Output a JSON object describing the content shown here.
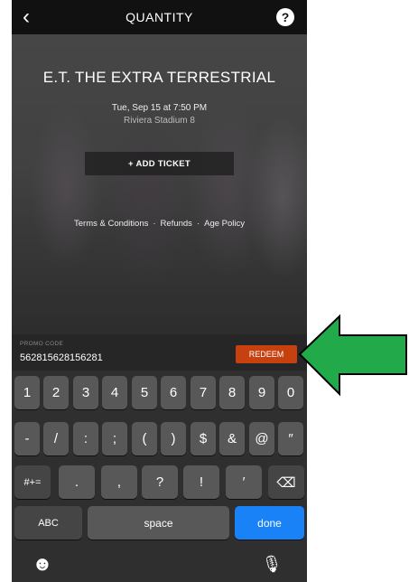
{
  "header": {
    "title": "QUANTITY",
    "back_glyph": "‹",
    "help_glyph": "?"
  },
  "event": {
    "title": "E.T. THE EXTRA TERRESTRIAL",
    "showtime": "Tue, Sep 15 at 7:50 PM",
    "theater": "Riviera Stadium 8",
    "add_ticket": "+ ADD TICKET"
  },
  "links": {
    "terms": "Terms & Conditions",
    "refunds": "Refunds",
    "age": "Age Policy",
    "separator": "·"
  },
  "promo": {
    "label": "PROMO CODE",
    "value": "562815628156281",
    "button": "REDEEM"
  },
  "keyboard": {
    "row1": [
      "1",
      "2",
      "3",
      "4",
      "5",
      "6",
      "7",
      "8",
      "9",
      "0"
    ],
    "row2": [
      "-",
      "/",
      ":",
      ";",
      "(",
      ")",
      "$",
      "&",
      "@",
      "″"
    ],
    "row3_mode": "#+=",
    "row3": [
      ".",
      ",",
      "?",
      "!",
      "′"
    ],
    "delete_glyph": "⌫",
    "abc": "ABC",
    "space": "space",
    "done": "done",
    "emoji_glyph": "☻",
    "mic_glyph": "🎙"
  },
  "colors": {
    "accent": "#c6410f",
    "done": "#1a82f7",
    "arrow": "#22a94a"
  }
}
